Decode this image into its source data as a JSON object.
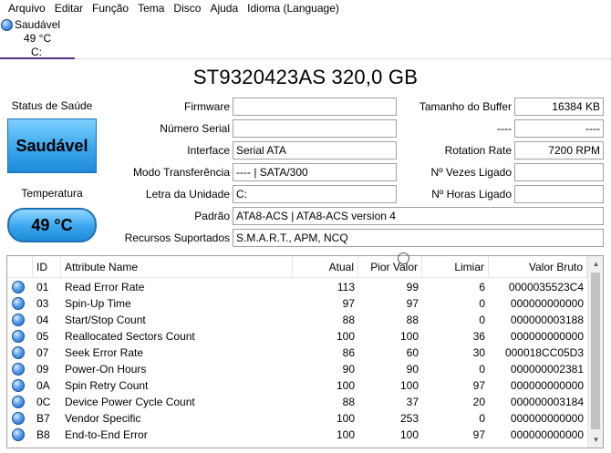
{
  "menu": [
    "Arquivo",
    "Editar",
    "Função",
    "Tema",
    "Disco",
    "Ajuda",
    "Idioma (Language)"
  ],
  "drive_tab": {
    "status": "Saudável",
    "temperature": "49 °C",
    "letter": "C:"
  },
  "title": "ST9320423AS 320,0 GB",
  "health": {
    "label": "Status de Saúde",
    "value": "Saudável"
  },
  "temperature": {
    "label": "Temperatura",
    "value": "49 °C"
  },
  "info": {
    "firmware_label": "Firmware",
    "firmware": "",
    "serial_label": "Número Serial",
    "serial": "",
    "interface_label": "Interface",
    "interface": "Serial ATA",
    "transfer_label": "Modo Transferência",
    "transfer": "---- | SATA/300",
    "letter_label": "Letra da Unidade",
    "letter": "C:",
    "standard_label": "Padrão",
    "standard": "ATA8-ACS | ATA8-ACS version 4",
    "features_label": "Recursos Suportados",
    "features": "S.M.A.R.T., APM, NCQ",
    "buffer_label": "Tamanho do Buffer",
    "buffer": "16384 KB",
    "extra_label": "----",
    "extra": "----",
    "rotation_label": "Rotation Rate",
    "rotation": "7200 RPM",
    "power_on_count_label": "Nº Vezes Ligado",
    "power_on_count": "",
    "power_on_hours_label": "Nº Horas Ligado",
    "power_on_hours": ""
  },
  "table": {
    "headers": {
      "id": "ID",
      "name": "Attribute Name",
      "current": "Atual",
      "worst": "Pior Valor",
      "threshold": "Limiar",
      "raw": "Valor Bruto"
    },
    "rows": [
      {
        "id": "01",
        "name": "Read Error Rate",
        "current": "113",
        "worst": "99",
        "threshold": "6",
        "raw": "0000035523C4"
      },
      {
        "id": "03",
        "name": "Spin-Up Time",
        "current": "97",
        "worst": "97",
        "threshold": "0",
        "raw": "000000000000"
      },
      {
        "id": "04",
        "name": "Start/Stop Count",
        "current": "88",
        "worst": "88",
        "threshold": "0",
        "raw": "000000003188"
      },
      {
        "id": "05",
        "name": "Reallocated Sectors Count",
        "current": "100",
        "worst": "100",
        "threshold": "36",
        "raw": "000000000000"
      },
      {
        "id": "07",
        "name": "Seek Error Rate",
        "current": "86",
        "worst": "60",
        "threshold": "30",
        "raw": "000018CC05D3"
      },
      {
        "id": "09",
        "name": "Power-On Hours",
        "current": "90",
        "worst": "90",
        "threshold": "0",
        "raw": "000000002381"
      },
      {
        "id": "0A",
        "name": "Spin Retry Count",
        "current": "100",
        "worst": "100",
        "threshold": "97",
        "raw": "000000000000"
      },
      {
        "id": "0C",
        "name": "Device Power Cycle Count",
        "current": "88",
        "worst": "37",
        "threshold": "20",
        "raw": "000000003184"
      },
      {
        "id": "B7",
        "name": "Vendor Specific",
        "current": "100",
        "worst": "253",
        "threshold": "0",
        "raw": "000000000000"
      },
      {
        "id": "B8",
        "name": "End-to-End Error",
        "current": "100",
        "worst": "100",
        "threshold": "97",
        "raw": "000000000000"
      }
    ]
  },
  "colors": {
    "health_blue": "#3aa6ee",
    "tab_underline": "#5b2d86"
  }
}
